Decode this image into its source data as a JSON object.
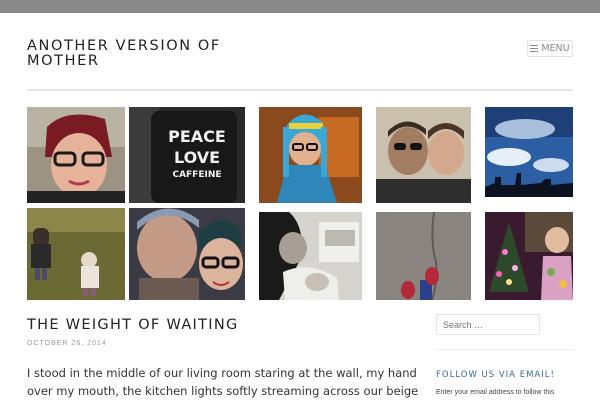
{
  "site": {
    "title": "ANOTHER VERSION OF MOTHER"
  },
  "header": {
    "menu_label": "MENU"
  },
  "gallery": {
    "tiles": [
      {
        "name": "photo-woman-glasses-selfie"
      },
      {
        "name": "photo-peace-love-caffeine-mug",
        "text": [
          "PEACE",
          "LOVE",
          "CAFFEINE"
        ]
      },
      {
        "name": "photo-child-knit-hat"
      },
      {
        "name": "photo-man-and-boy"
      },
      {
        "name": "photo-sky-clouds-skyline"
      },
      {
        "name": "photo-children-field"
      },
      {
        "name": "photo-couple-selfie"
      },
      {
        "name": "photo-mother-baby-kitchen"
      },
      {
        "name": "photo-feet-pavement"
      },
      {
        "name": "photo-child-christmas-tree"
      }
    ]
  },
  "post": {
    "title": "THE WEIGHT OF WAITING",
    "date": "OCTOBER 26, 2014",
    "body": "I stood in the middle of our living room staring at the wall, my hand over my mouth, the kitchen lights softly streaming across our beige carpet."
  },
  "sidebar": {
    "search_placeholder": "Search …",
    "follow_heading": "FOLLOW US VIA EMAIL!",
    "follow_text": "Enter your email address to follow this"
  },
  "colors": {
    "topbar": "#8a8a8a",
    "link": "#3a6b96",
    "text": "#333333"
  }
}
